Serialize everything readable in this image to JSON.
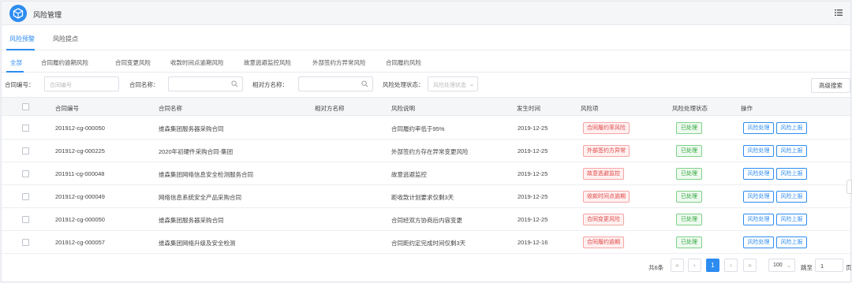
{
  "app": {
    "title": "风险管理",
    "menu_icon": "list-menu-icon",
    "logo_icon": "cube-logo-icon",
    "accent": "#2d8cf0"
  },
  "top_tabs": [
    {
      "label": "风险预警",
      "active": true
    },
    {
      "label": "风险提点",
      "active": false
    }
  ],
  "sub_tabs": [
    {
      "label": "全部",
      "active": true
    },
    {
      "label": "合同履约逾期风险"
    },
    {
      "label": "合同变更风险"
    },
    {
      "label": "收款时间点逾期风险"
    },
    {
      "label": "故意逃避监控风险"
    },
    {
      "label": "外部签约方异常风险"
    },
    {
      "label": "合同履约风险"
    }
  ],
  "filters": {
    "contract_no_label": "合同编号：",
    "contract_no_placeholder": "合同编号",
    "contract_name_label": "合同名称：",
    "counterparty_label": "相对方名称：",
    "status_label": "风险处理状态：",
    "status_placeholder": "风险处理状态",
    "advanced_search": "高级搜索"
  },
  "table": {
    "columns": [
      "合同编号",
      "合同名称",
      "相对方名称",
      "风险说明",
      "发生时间",
      "风险项",
      "风险处理状态",
      "操作"
    ],
    "actions": {
      "handle": "风险处理",
      "report": "风险上报"
    },
    "rows": [
      {
        "no": "201912-cg-000050",
        "name": "维森集团服务器采购合同",
        "party": "",
        "desc": "合同履约率低于95%",
        "date": "2019-12-25",
        "risk": "合同履约率风险",
        "status": "已处理"
      },
      {
        "no": "201912-cg-000225",
        "name": "2020年初硬件采购合同-集团",
        "party": "",
        "desc": "外部签约方存在异常变更风险",
        "date": "2019-12-25",
        "risk": "外部签约方异常",
        "status": "已处理"
      },
      {
        "no": "201911-cg-000048",
        "name": "维森集团网络信息安全检测服务合同",
        "party": "",
        "desc": "故意逃避监控",
        "date": "2019-12-25",
        "risk": "故意逃避监控",
        "status": "已处理"
      },
      {
        "no": "201912-cg-000049",
        "name": "网络信息系统安全产品采购合同",
        "party": "",
        "desc": "距收款计划要求仅剩3天",
        "date": "2019-12-25",
        "risk": "收款时间点逾期",
        "status": "已处理"
      },
      {
        "no": "201912-cg-000050",
        "name": "维森集团服务器采购合同",
        "party": "",
        "desc": "合同经双方协商后内容变更",
        "date": "2019-12-25",
        "risk": "合同变更风险",
        "status": "已处理"
      },
      {
        "no": "201912-cg-000057",
        "name": "维森集团网络升级及安全检测",
        "party": "",
        "desc": "合同距约定完成时间仅剩3天",
        "date": "2019-12-16",
        "risk": "合同履约逾期",
        "status": "已处理"
      }
    ]
  },
  "pager": {
    "total": "共6条",
    "current_page": "1",
    "page_size": "100",
    "jump_label": "跳至",
    "jump_value": "1",
    "page_unit": "页"
  }
}
